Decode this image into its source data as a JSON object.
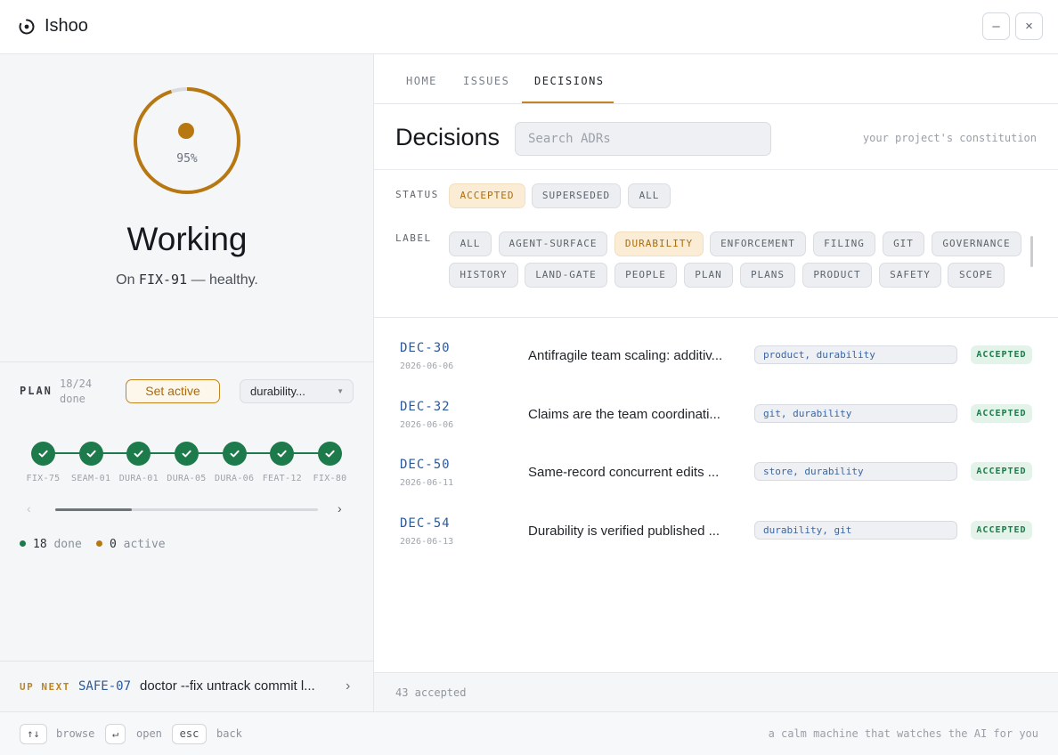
{
  "app": {
    "title": "Ishoo",
    "minimize_label": "–",
    "close_label": "×"
  },
  "status": {
    "percent_label": "95%",
    "percent": 95,
    "title": "Working",
    "sub_prefix": "On",
    "sub_issue": "FIX-91",
    "sub_suffix": "— healthy."
  },
  "plan": {
    "label": "PLAN",
    "count": "18/24",
    "count_suffix": "done",
    "set_active_label": "Set active",
    "selected": "durability...",
    "steps": [
      "FIX-75",
      "SEAM-01",
      "DURA-01",
      "DURA-05",
      "DURA-06",
      "FEAT-12",
      "FIX-80"
    ],
    "scroll_left": "‹",
    "scroll_right": "›",
    "done_count": "18",
    "done_label": "done",
    "active_count": "0",
    "active_label": "active"
  },
  "up_next": {
    "label": "UP NEXT",
    "id": "SAFE-07",
    "text": "doctor --fix untrack commit l...",
    "chevron": "›"
  },
  "tabs": [
    "HOME",
    "ISSUES",
    "DECISIONS"
  ],
  "decisions": {
    "title": "Decisions",
    "search_placeholder": "Search ADRs",
    "tagline": "your project's constitution",
    "status_label": "STATUS",
    "status_chips": [
      "ACCEPTED",
      "SUPERSEDED",
      "ALL"
    ],
    "label_label": "LABEL",
    "label_chips_row1": [
      "ALL",
      "AGENT-SURFACE",
      "DURABILITY",
      "ENFORCEMENT",
      "FILING",
      "GIT",
      "GOVERNANCE"
    ],
    "label_chips_row2": [
      "HISTORY",
      "LAND-GATE",
      "PEOPLE",
      "PLAN",
      "PLANS",
      "PRODUCT",
      "SAFETY",
      "SCOPE"
    ],
    "rows": [
      {
        "id": "DEC-30",
        "date": "2026-06-06",
        "title": "Antifragile team scaling: additiv...",
        "labels": "product, durability",
        "status": "ACCEPTED"
      },
      {
        "id": "DEC-32",
        "date": "2026-06-06",
        "title": "Claims are the team coordinati...",
        "labels": "git, durability",
        "status": "ACCEPTED"
      },
      {
        "id": "DEC-50",
        "date": "2026-06-11",
        "title": "Same-record concurrent edits ...",
        "labels": "store, durability",
        "status": "ACCEPTED"
      },
      {
        "id": "DEC-54",
        "date": "2026-06-13",
        "title": "Durability is verified published ...",
        "labels": "durability, git",
        "status": "ACCEPTED"
      }
    ],
    "footer_count": "43 accepted"
  },
  "bottom": {
    "keys": [
      {
        "key": "↑↓",
        "label": "browse"
      },
      {
        "key": "↵",
        "label": "open"
      },
      {
        "key": "esc",
        "label": "back"
      }
    ],
    "tagline": "a calm machine that watches the AI for you"
  },
  "colors": {
    "accent": "#c08423",
    "success": "#1c7a4b",
    "link": "#2a5a9c"
  }
}
